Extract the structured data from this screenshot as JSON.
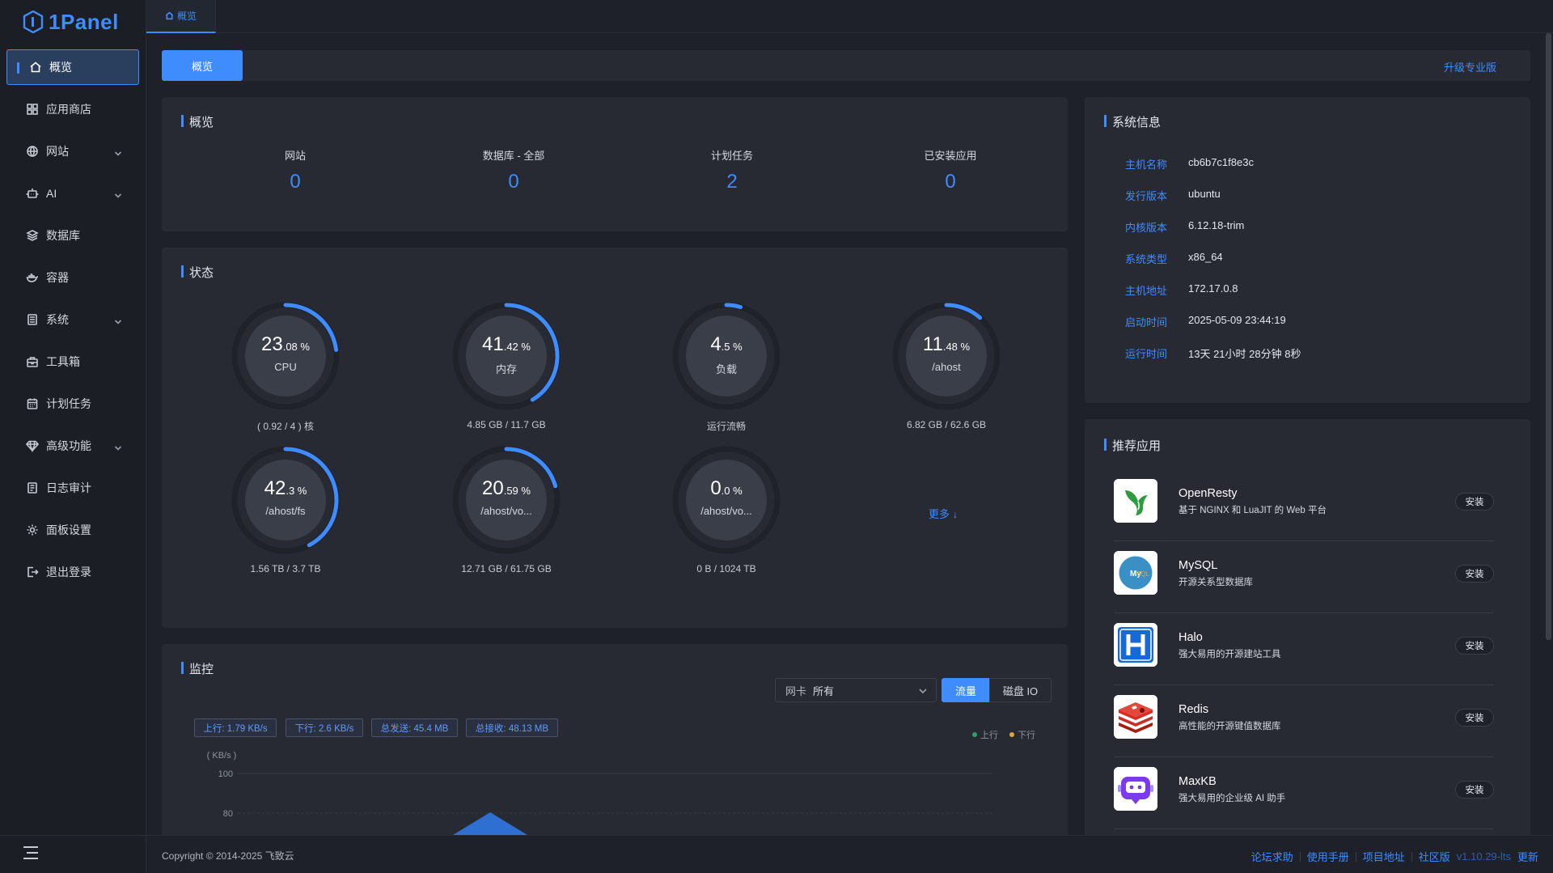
{
  "brand": {
    "name": "1Panel"
  },
  "breadcrumb": {
    "label": "概览"
  },
  "sidebar": {
    "items": [
      {
        "label": "概览",
        "icon": "home-icon",
        "active": true
      },
      {
        "label": "应用商店",
        "icon": "grid-icon"
      },
      {
        "label": "网站",
        "icon": "globe-icon",
        "expandable": true
      },
      {
        "label": "AI",
        "icon": "robot-icon",
        "expandable": true
      },
      {
        "label": "数据库",
        "icon": "layers-icon"
      },
      {
        "label": "容器",
        "icon": "docker-icon"
      },
      {
        "label": "系统",
        "icon": "server-icon",
        "expandable": true
      },
      {
        "label": "工具箱",
        "icon": "toolbox-icon"
      },
      {
        "label": "计划任务",
        "icon": "calendar-icon"
      },
      {
        "label": "高级功能",
        "icon": "diamond-icon",
        "expandable": true
      },
      {
        "label": "日志审计",
        "icon": "log-icon"
      },
      {
        "label": "面板设置",
        "icon": "gear-icon"
      },
      {
        "label": "退出登录",
        "icon": "logout-icon"
      }
    ]
  },
  "subbar": {
    "tab_label": "概览",
    "upgrade_label": "升级专业版"
  },
  "overview": {
    "title": "概览",
    "stats": [
      {
        "label": "网站",
        "value": "0"
      },
      {
        "label": "数据库 - 全部",
        "value": "0"
      },
      {
        "label": "计划任务",
        "value": "2"
      },
      {
        "label": "已安装应用",
        "value": "0"
      }
    ]
  },
  "status": {
    "title": "状态",
    "gauges": [
      {
        "int": "23",
        "dec": ".08 %",
        "name": "CPU",
        "sub": "( 0.92 / 4 ) 核",
        "percent": 23.08
      },
      {
        "int": "41",
        "dec": ".42 %",
        "name": "内存",
        "sub": "4.85 GB / 11.7 GB",
        "percent": 41.42
      },
      {
        "int": "4",
        "dec": ".5 %",
        "name": "负载",
        "sub": "运行流畅",
        "percent": 4.5
      },
      {
        "int": "11",
        "dec": ".48 %",
        "name": "/ahost",
        "sub": "6.82 GB / 62.6 GB",
        "percent": 11.48
      },
      {
        "int": "42",
        "dec": ".3 %",
        "name": "/ahost/fs",
        "sub": "1.56 TB / 3.7 TB",
        "percent": 42.3
      },
      {
        "int": "20",
        "dec": ".59 %",
        "name": "/ahost/vo...",
        "sub": "12.71 GB / 61.75 GB",
        "percent": 20.59
      },
      {
        "int": "0",
        "dec": ".0 %",
        "name": "/ahost/vo...",
        "sub": "0 B / 1024 TB",
        "percent": 0
      }
    ],
    "more_label": "更多 ↓"
  },
  "monitor": {
    "title": "监控",
    "nic_label": "网卡",
    "nic_value": "所有",
    "tabs": [
      "流量",
      "磁盘 IO"
    ],
    "pills": [
      "上行: 1.79 KB/s",
      "下行: 2.6 KB/s",
      "总发送: 45.4 MB",
      "总接收: 48.13 MB"
    ],
    "legend": [
      "上行",
      "下行"
    ],
    "legend_colors": [
      "#2ea06b",
      "#e0a53a"
    ]
  },
  "chart_data": {
    "type": "area",
    "ylabel": "( KB/s )",
    "yticks": [
      "100",
      "80"
    ],
    "series": [
      {
        "name": "上行",
        "color": "#2ea06b"
      },
      {
        "name": "下行",
        "color": "#3f8cff"
      }
    ]
  },
  "sysinfo": {
    "title": "系统信息",
    "rows": [
      {
        "k": "主机名称",
        "v": "cb6b7c1f8e3c"
      },
      {
        "k": "发行版本",
        "v": "ubuntu"
      },
      {
        "k": "内核版本",
        "v": "6.12.18-trim"
      },
      {
        "k": "系统类型",
        "v": "x86_64"
      },
      {
        "k": "主机地址",
        "v": "172.17.0.8"
      },
      {
        "k": "启动时间",
        "v": "2025-05-09 23:44:19"
      },
      {
        "k": "运行时间",
        "v": "13天 21小时 28分钟 8秒"
      }
    ]
  },
  "apps": {
    "title": "推荐应用",
    "install_label": "安装",
    "items": [
      {
        "name": "OpenResty",
        "desc": "基于 NGINX 和 LuaJIT 的 Web 平台",
        "icon": "openresty-icon"
      },
      {
        "name": "MySQL",
        "desc": "开源关系型数据库",
        "icon": "mysql-icon"
      },
      {
        "name": "Halo",
        "desc": "强大易用的开源建站工具",
        "icon": "halo-icon"
      },
      {
        "name": "Redis",
        "desc": "高性能的开源键值数据库",
        "icon": "redis-icon"
      },
      {
        "name": "MaxKB",
        "desc": "强大易用的企业级 AI 助手",
        "icon": "maxkb-icon"
      }
    ]
  },
  "footer": {
    "copyright": "Copyright © 2014-2025 飞致云",
    "links": [
      "论坛求助",
      "使用手册",
      "项目地址",
      "社区版"
    ],
    "version": "v1.10.29-lts",
    "update_label": "更新"
  },
  "colors": {
    "accent": "#3f8cff",
    "bg": "#1e2129",
    "card": "#272a33"
  }
}
